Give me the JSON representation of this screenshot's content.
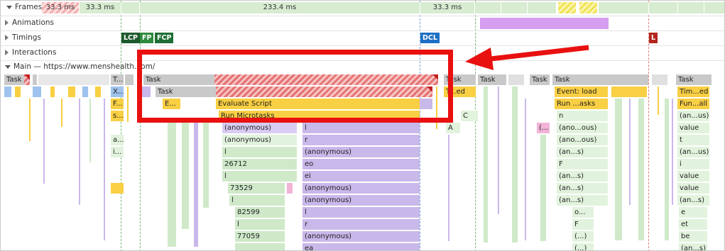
{
  "tracks": {
    "frames": "Frames",
    "animations": "Animations",
    "timings": "Timings",
    "interactions": "Interactions",
    "main": "Main — https://www.menshealth.com/"
  },
  "frames": {
    "seg1": "33.3 ms",
    "seg2": "33.3 ms",
    "seg3": "233.4 ms",
    "seg4": "33.3 ms"
  },
  "markers": {
    "lcp": "LCP",
    "fp": "FP",
    "fcp": "FCP",
    "dcl": "DCL",
    "l": "L"
  },
  "colors": {
    "lcp": "#1e5a2e",
    "fp": "#2f8a3f",
    "fcp": "#1f6e35",
    "dcl": "#1e6fc4",
    "l": "#b3261e",
    "highlight": "#e91010",
    "task_yellow": "#f9cf43",
    "purple": "#c9b8ea"
  },
  "flame": {
    "task_a": "Task",
    "task_b": "T...",
    "task_c": "Task",
    "task_inner": "Task",
    "task_d": "Task",
    "task_e": "Task",
    "task_f": "Task",
    "task_g": "Task",
    "task_h": "Task",
    "x": "X...",
    "f": "F...",
    "s": "s...",
    "a": "a...",
    "i": "i...",
    "e": "E...",
    "evaluate_script": "Evaluate Script",
    "run_microtasks": "Run Microtasks",
    "anon1": "(anonymous)",
    "anon2": "(anonymous)",
    "l1": "l",
    "n26712": "26712",
    "l2": "l",
    "n73529": "73529",
    "l3": "l",
    "n82599": "82599",
    "l4": "l",
    "n77059": "77059",
    "r1": "r",
    "l5": "l",
    "r2": "r",
    "anon3": "(anonymous)",
    "eo": "eo",
    "ei": "ei",
    "anon4": "(anonymous)",
    "anon5": "(anonymous)",
    "l6": "l",
    "r3": "r",
    "anon6": "(anonymous)",
    "ea": "ea",
    "ted": "T...ed",
    "c": "C",
    "a_col": "A",
    "paren": "(...",
    "event_load": "Event: load",
    "run_asks": "Run ...asks",
    "n": "n",
    "anon_ous1": "(ano...ous)",
    "anon_ous2": "(ano...ous)",
    "an_s1": "(an...s)",
    "F": "F",
    "an_s2": "(an...s)",
    "an_s3": "(an...s)",
    "an_s4": "(an...s)",
    "o": "o...",
    "F2": "F",
    "paren2": "(...)",
    "paren3": "(...)",
    "timed": "Tim...ed",
    "funall": "Fun...all",
    "an_us1": "(an...us)",
    "value1": "value",
    "t": "t",
    "an_us2": "(an...us)",
    "i2": "i",
    "value2": "value",
    "value3": "value",
    "an_s5": "(an...s)",
    "e2": "e",
    "et": "et",
    "be": "be",
    "an_s6": "(an...s)"
  }
}
